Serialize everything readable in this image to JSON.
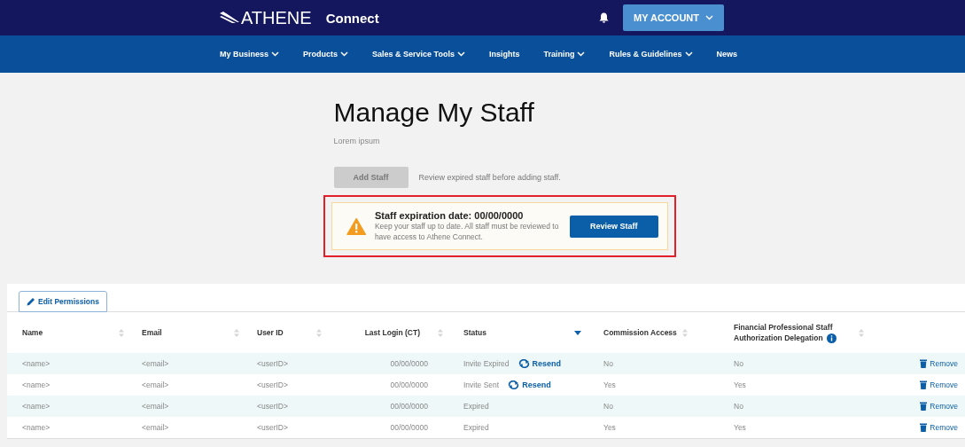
{
  "header": {
    "logo": "ATHENE",
    "app_name": "Connect",
    "account_button": "MY ACCOUNT"
  },
  "nav": [
    {
      "label": "My Business",
      "dropdown": true
    },
    {
      "label": "Products",
      "dropdown": true
    },
    {
      "label": "Sales & Service Tools",
      "dropdown": true
    },
    {
      "label": "Insights",
      "dropdown": false
    },
    {
      "label": "Training",
      "dropdown": true
    },
    {
      "label": "Rules & Guidelines",
      "dropdown": true
    },
    {
      "label": "News",
      "dropdown": false
    }
  ],
  "page": {
    "title": "Manage My Staff",
    "subtitle": "Lorem ipsum",
    "add_button": {
      "label": "Add Staff",
      "disabled": true
    },
    "add_hint": "Review expired staff before adding staff."
  },
  "alert": {
    "highlighted": true,
    "title": "Staff expiration date: 00/00/0000",
    "message": "Keep your staff up to date. All staff must be reviewed to have access to Athene Connect.",
    "button": "Review Staff"
  },
  "edit_button": "Edit Permissions",
  "table": {
    "columns": [
      {
        "label": "Name",
        "sorted": false
      },
      {
        "label": "Email",
        "sorted": false
      },
      {
        "label": "User ID",
        "sorted": false
      },
      {
        "label": "Last Login (CT)",
        "sorted": false
      },
      {
        "label": "Status",
        "sorted": true
      },
      {
        "label": "Commission Access",
        "sorted": false
      },
      {
        "label": "Financial Professional Staff Authorization Delegation",
        "sorted": false,
        "info": true
      }
    ],
    "rows": [
      {
        "name": "<name>",
        "email": "<email>",
        "user_id": "<userID>",
        "last_login": "00/00/0000",
        "status": "Invite Expired",
        "action": "Resend",
        "commission": "No",
        "delegation": "No",
        "remove": "Remove"
      },
      {
        "name": "<name>",
        "email": "<email>",
        "user_id": "<userID>",
        "last_login": "00/00/0000",
        "status": "Invite Sent",
        "action": "Resend",
        "commission": "Yes",
        "delegation": "Yes",
        "remove": "Remove"
      },
      {
        "name": "<name>",
        "email": "<email>",
        "user_id": "<userID>",
        "last_login": "00/00/0000",
        "status": "Expired",
        "commission": "No",
        "delegation": "No",
        "remove": "Remove"
      },
      {
        "name": "<name>",
        "email": "<email>",
        "user_id": "<userID>",
        "last_login": "00/00/0000",
        "status": "Expired",
        "commission": "Yes",
        "delegation": "Yes",
        "remove": "Remove"
      }
    ]
  }
}
